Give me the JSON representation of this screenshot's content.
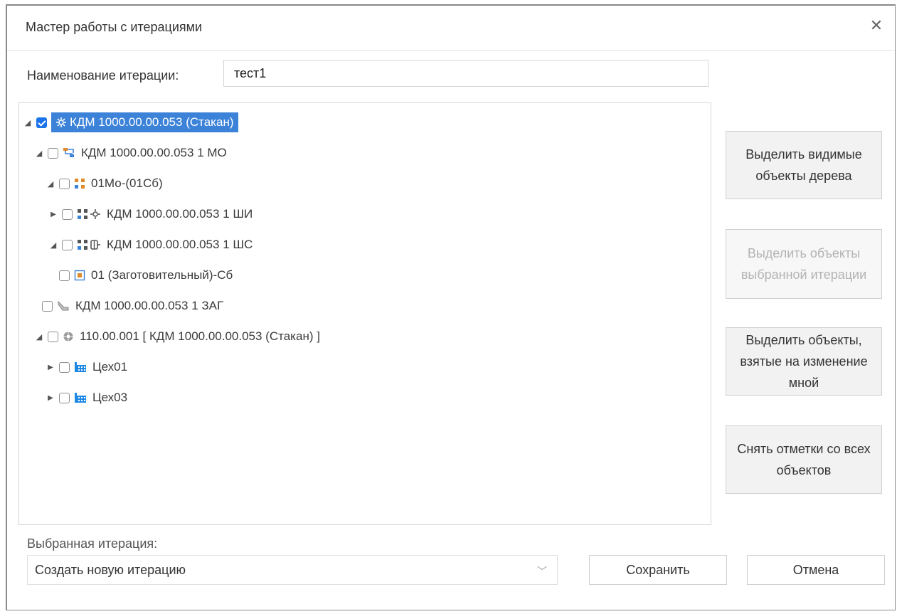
{
  "dialog": {
    "title": "Мастер работы с итерациями",
    "close_icon": "close-icon"
  },
  "name_field": {
    "label": "Наименование итерации:",
    "value": "тест1"
  },
  "tree": {
    "nodes": [
      {
        "label": "КДМ 1000.00.00.053 (Стакан)",
        "expanded": true,
        "checked": true,
        "selected": true,
        "icon": "gear-icon",
        "depth": 0
      },
      {
        "label": "КДМ 1000.00.00.053 1 МО",
        "expanded": true,
        "checked": false,
        "icon": "route-icon",
        "depth": 1
      },
      {
        "label": "01Мо-(01Сб)",
        "expanded": true,
        "checked": false,
        "icon": "operation-icon",
        "depth": 2
      },
      {
        "label": "КДМ 1000.00.00.053 1 ШИ",
        "expanded": false,
        "checked": false,
        "icon": "operation-gear-icon",
        "depth": 3
      },
      {
        "label": "КДМ 1000.00.00.053 1 ШС",
        "expanded": true,
        "checked": false,
        "icon": "operation-tool-icon",
        "depth": 3
      },
      {
        "label": "01 (Заготовительный)-Сб",
        "expanded": null,
        "checked": false,
        "icon": "workshop-op-icon",
        "depth": 4
      },
      {
        "label": "КДМ 1000.00.00.053 1 ЗАГ",
        "expanded": null,
        "checked": false,
        "icon": "pipe-icon",
        "depth": 1
      },
      {
        "label": "110.00.001 [ КДМ 1000.00.00.053 (Стакан) ]",
        "expanded": true,
        "checked": false,
        "icon": "disc-icon",
        "depth": 1
      },
      {
        "label": "Цех01",
        "expanded": false,
        "checked": false,
        "icon": "factory-icon",
        "depth": 2
      },
      {
        "label": "Цех03",
        "expanded": false,
        "checked": false,
        "icon": "factory-icon",
        "depth": 2
      }
    ]
  },
  "side_buttons": {
    "select_visible": "Выделить видимые объекты дерева",
    "select_iteration": "Выделить объекты выбранной итерации",
    "select_taken": "Выделить объекты, взятые на изменение мной",
    "clear_all": "Снять отметки со всех объектов"
  },
  "footer": {
    "iteration_label": "Выбранная итерация:",
    "iteration_value": "Создать новую итерацию",
    "save": "Сохранить",
    "cancel": "Отмена"
  },
  "colors": {
    "selection": "#3b82d8",
    "checkbox_checked": "#1a73e8"
  }
}
